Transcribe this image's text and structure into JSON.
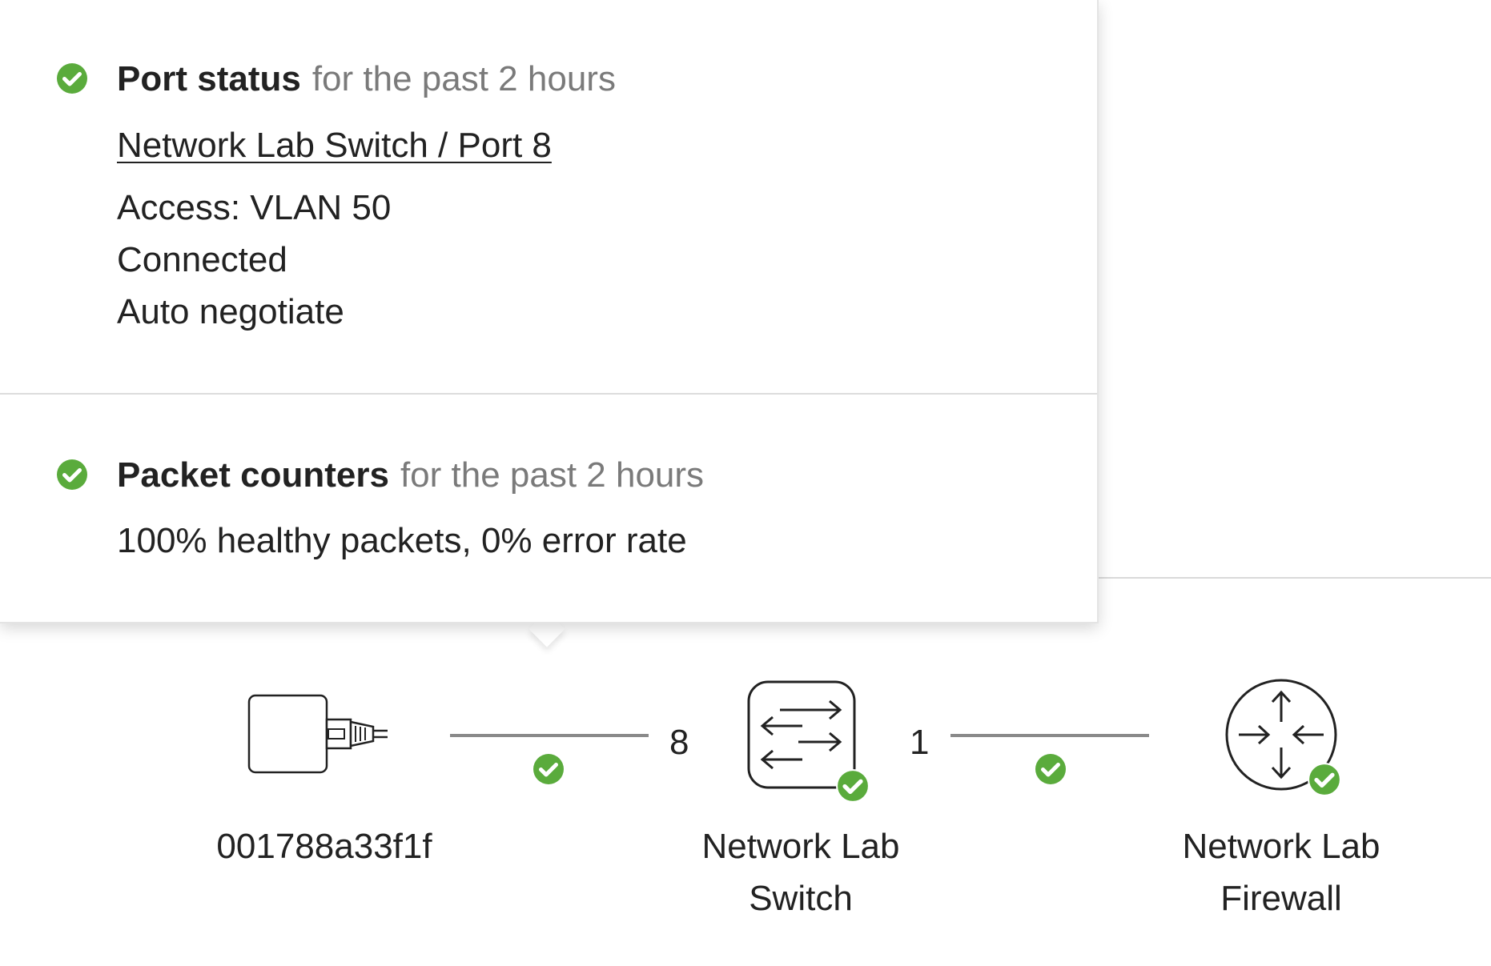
{
  "popover": {
    "port_status": {
      "title": "Port status",
      "subtitle": "for the past 2 hours",
      "link": "Network Lab Switch / Port 8",
      "lines": [
        "Access: VLAN 50",
        "Connected",
        "Auto negotiate"
      ],
      "status": "ok"
    },
    "packet_counters": {
      "title": "Packet counters",
      "subtitle": "for the past 2 hours",
      "summary": "100% healthy packets, 0% error rate",
      "status": "ok"
    }
  },
  "topology": {
    "client": {
      "label": "001788a33f1f",
      "icon": "ethernet-device-icon"
    },
    "link_client_switch": {
      "status": "ok"
    },
    "switch_port": "8",
    "switch": {
      "label_line1": "Network Lab",
      "label_line2": "Switch",
      "icon": "switch-icon",
      "status": "ok"
    },
    "uplink_port": "1",
    "link_switch_firewall": {
      "status": "ok"
    },
    "firewall": {
      "label_line1": "Network Lab",
      "label_line2": "Firewall",
      "icon": "firewall-router-icon",
      "status": "ok"
    }
  },
  "colors": {
    "ok_green": "#5aab3c",
    "muted_text": "#7a7a7a",
    "connector": "#8a8a8a"
  }
}
